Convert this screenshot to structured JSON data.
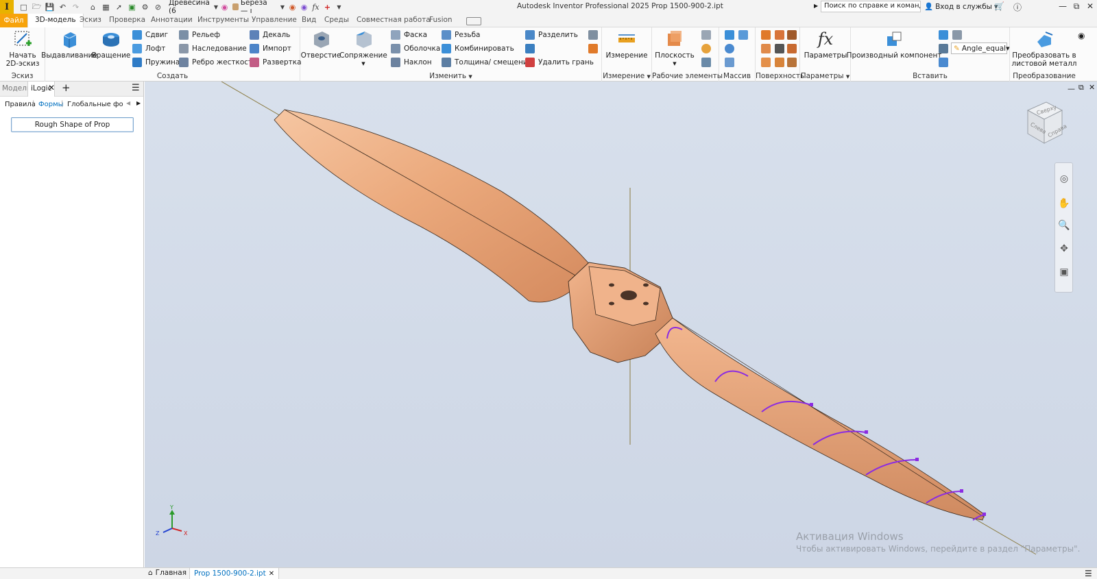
{
  "titlebar": {
    "logo": "I",
    "material_select": "Древесина (6",
    "appearance_select": "Береза — ı",
    "app_title": "Autodesk Inventor Professional 2025   Prop 1500-900-2.ipt",
    "search_text": "Поиск по справке и командам...",
    "signin_label": "Вход в службы",
    "fx_label": "fx"
  },
  "tabs": [
    "Файл",
    "3D-модель",
    "Эскиз",
    "Проверка",
    "Аннотации",
    "Инструменты",
    "Управление",
    "Вид",
    "Среды",
    "Совместная работа",
    "Fusion"
  ],
  "ribbon": {
    "sketch": {
      "start_line1": "Начать",
      "start_line2": "2D-эскиз",
      "label": "Эскиз"
    },
    "create": {
      "extrude": "Выдавливание",
      "revolve": "Вращение",
      "sweep": "Сдвиг",
      "loft": "Лофт",
      "coil": "Пружина",
      "emboss": "Рельеф",
      "derive": "Наследование",
      "rib": "Ребро жесткости",
      "decal": "Декаль",
      "import": "Импорт",
      "unwrap": "Развертка",
      "label": "Создать"
    },
    "modify": {
      "hole": "Отверстие",
      "fillet": "Сопряжение",
      "chamfer": "Фаска",
      "shell": "Оболочка",
      "draft": "Наклон",
      "thread": "Резьба",
      "combine": "Комбинировать",
      "thicken": "Толщина/ смещение",
      "split": "Разделить",
      "delete_face": "Удалить грань",
      "label": "Изменить"
    },
    "measure": {
      "measure": "Измерение",
      "label": "Измерение"
    },
    "work": {
      "plane": "Плоскость",
      "label": "Рабочие элементы"
    },
    "pattern": {
      "label": "Массив"
    },
    "surface": {
      "label": "Поверхность"
    },
    "params": {
      "fx": "fx",
      "params": "Параметры",
      "label": "Параметры"
    },
    "insert": {
      "derived": "Производный компонент",
      "angle_select": "Angle_equal",
      "label": "Вставить"
    },
    "convert": {
      "line1": "Преобразовать в",
      "line2": "листовой металл",
      "label": "Преобразование"
    }
  },
  "leftpanel": {
    "tab_model": "Модель",
    "tab_logic": "iLogic",
    "filter_rules": "Правила",
    "filter_forms": "Формы",
    "filter_global": "Глобальные формы",
    "rule_button": "Rough Shape of Prop"
  },
  "viewcube": {
    "top": "Сверху",
    "left": "Слева",
    "right": "Справа"
  },
  "axis": {
    "y": "Y",
    "z": "Z",
    "x": "X"
  },
  "activation": {
    "line1": "Активация Windows",
    "line2": "Чтобы активировать Windows, перейдите в раздел \"Параметры\"."
  },
  "statusbar": {
    "home": "Главная",
    "doc_tab": "Prop 1500-900-2.ipt"
  },
  "colors": {
    "file_tab": "#f7a30a",
    "accent": "#0070c0",
    "viewport": "#d2dae7",
    "wood": "#e9ad84",
    "spline": "#8b2be2"
  }
}
